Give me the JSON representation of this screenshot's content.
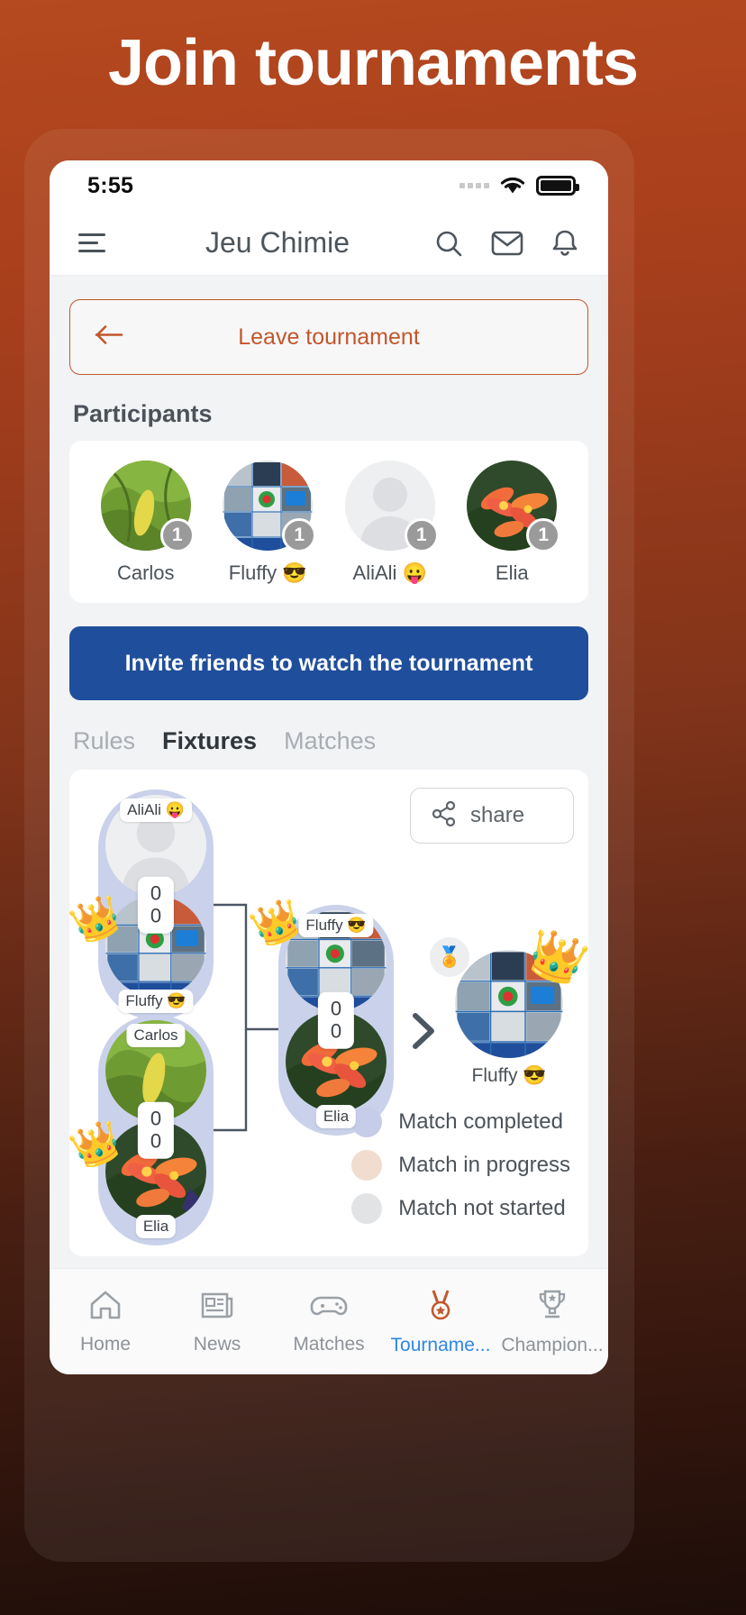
{
  "banner": {
    "title": "Join tournaments"
  },
  "status_bar": {
    "time": "5:55",
    "wifi_icon": "wifi-icon",
    "battery_icon": "battery-full-icon",
    "signal_icon": "signal-dots-icon"
  },
  "header": {
    "menu_icon": "hamburger-menu-icon",
    "title": "Jeu Chimie",
    "search_icon": "search-icon",
    "mail_icon": "mail-icon",
    "bell_icon": "bell-icon"
  },
  "leave_button": {
    "label": "Leave tournament",
    "icon": "arrow-left-icon",
    "color": "#c2572c"
  },
  "participants": {
    "section_title": "Participants",
    "items": [
      {
        "name": "Carlos",
        "badge": "1",
        "avatar": "photo-green-leaves"
      },
      {
        "name": "Fluffy 😎",
        "badge": "1",
        "avatar": "photo-collage"
      },
      {
        "name": "AliAli 😛",
        "badge": "1",
        "avatar": "placeholder-person"
      },
      {
        "name": "Elia",
        "badge": "1",
        "avatar": "photo-orange-flowers"
      }
    ]
  },
  "invite_button": {
    "label": "Invite friends to watch the tournament",
    "color": "#1f4e9c"
  },
  "tabs": [
    {
      "label": "Rules",
      "active": false
    },
    {
      "label": "Fixtures",
      "active": true
    },
    {
      "label": "Matches",
      "active": false
    }
  ],
  "bracket": {
    "share_button": {
      "label": "share",
      "icon": "share-nodes-icon"
    },
    "matches": [
      {
        "id": "semi-1",
        "top": {
          "name": "AliAli 😛",
          "score": "0",
          "avatar": "placeholder-person",
          "winner": false
        },
        "bottom": {
          "name": "Fluffy 😎",
          "score": "0",
          "avatar": "photo-collage",
          "winner": true
        },
        "status": "completed"
      },
      {
        "id": "semi-2",
        "top": {
          "name": "Carlos",
          "score": "0",
          "avatar": "photo-green-leaves",
          "winner": false
        },
        "bottom": {
          "name": "Elia",
          "score": "0",
          "avatar": "photo-orange-flowers",
          "winner": true
        },
        "status": "completed"
      },
      {
        "id": "final",
        "top": {
          "name": "Fluffy 😎",
          "score": "0",
          "avatar": "photo-collage",
          "winner": true
        },
        "bottom": {
          "name": "Elia",
          "score": "0",
          "avatar": "photo-orange-flowers",
          "winner": false
        },
        "status": "completed"
      }
    ],
    "champion": {
      "name": "Fluffy 😎",
      "avatar": "photo-collage",
      "medal_icon": "medal-icon",
      "crown_icon": "crown-icon"
    },
    "chevron_icon": "chevron-right-icon",
    "legend": [
      {
        "label": "Match completed",
        "color": "#c5cde8"
      },
      {
        "label": "Match in progress",
        "color": "#f0ddd0"
      },
      {
        "label": "Match not started",
        "color": "#e2e3e5"
      }
    ]
  },
  "bottom_nav": [
    {
      "label": "Home",
      "icon": "home-icon",
      "active": false
    },
    {
      "label": "News",
      "icon": "newspaper-icon",
      "active": false
    },
    {
      "label": "Matches",
      "icon": "gamepad-icon",
      "active": false
    },
    {
      "label": "Tourname...",
      "icon": "medal-icon",
      "active": true
    },
    {
      "label": "Champion...",
      "icon": "trophy-icon",
      "active": false
    }
  ]
}
